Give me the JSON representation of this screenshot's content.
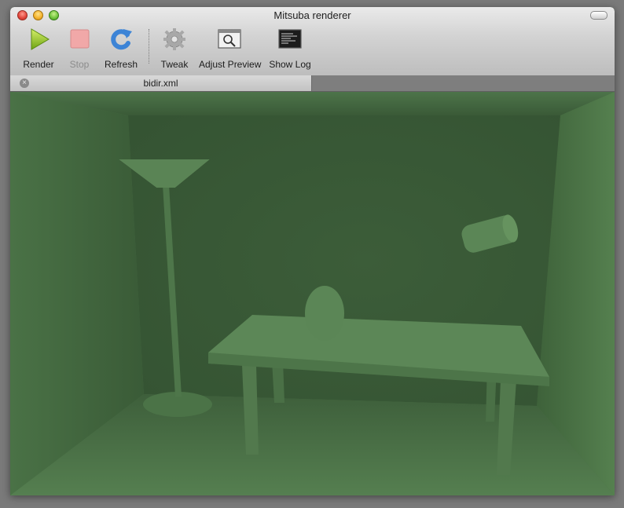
{
  "window": {
    "title": "Mitsuba renderer"
  },
  "toolbar": {
    "render_label": "Render",
    "stop_label": "Stop",
    "refresh_label": "Refresh",
    "tweak_label": "Tweak",
    "adjust_preview_label": "Adjust Preview",
    "show_log_label": "Show Log"
  },
  "tabs": [
    {
      "label": "bidir.xml",
      "close_glyph": "×"
    }
  ],
  "icons": {
    "render": "play-icon",
    "stop": "stop-icon",
    "refresh": "refresh-icon",
    "tweak": "gear-icon",
    "adjust_preview": "magnifier-window-icon",
    "show_log": "terminal-icon"
  },
  "colors": {
    "scene_tint": "#4f7a4b",
    "play_green": "#8fc41e",
    "refresh_blue": "#3a7fd0",
    "stop_disabled": "#f0a2a2"
  }
}
